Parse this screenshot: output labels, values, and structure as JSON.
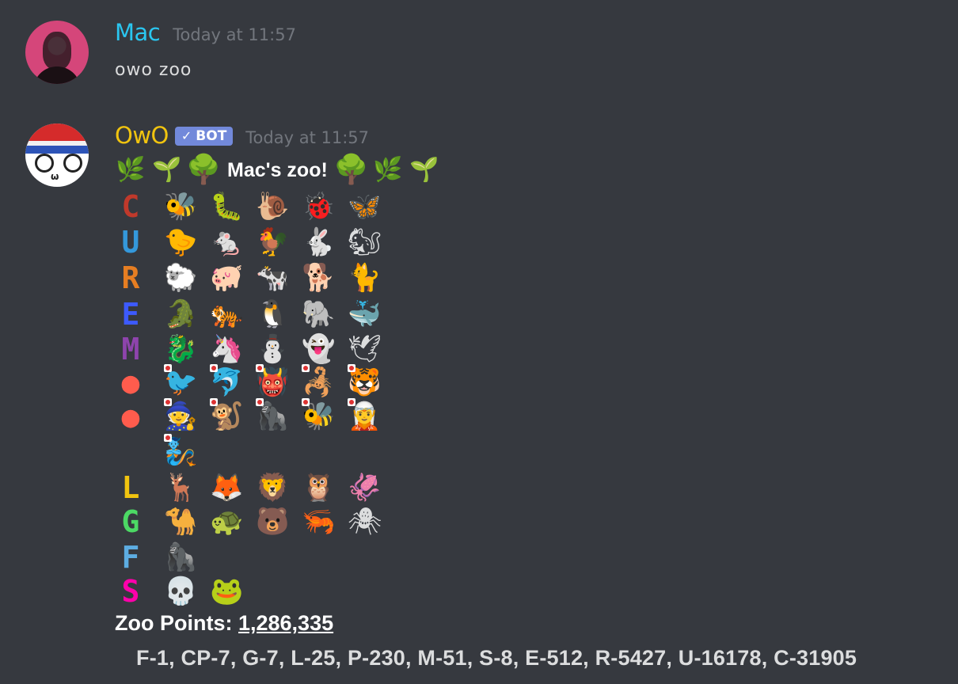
{
  "messages": [
    {
      "username": "Mac",
      "timestamp": "Today at 11:57",
      "content": "owo zoo",
      "avatar": "user-avatar"
    },
    {
      "username": "OwO",
      "bot_tag": "BOT",
      "timestamp": "Today at 11:57",
      "avatar": "owo-bot-avatar"
    }
  ],
  "zoo": {
    "title": "Mac's zoo!",
    "title_decorations_left": [
      "🌿",
      "🌱",
      "🌳"
    ],
    "title_decorations_right": [
      "🌳",
      "🌿",
      "🌱"
    ],
    "rows": [
      {
        "rank": "common",
        "rank_glyph": "C",
        "rank_color": "#c0392b",
        "animals": [
          "🐝",
          "🐛",
          "🐌",
          "🐞",
          "🦋"
        ]
      },
      {
        "rank": "uncommon",
        "rank_glyph": "U",
        "rank_color": "#3498db",
        "animals": [
          "🐤",
          "🐁",
          "🐓",
          "🐇",
          "🐿"
        ]
      },
      {
        "rank": "rare",
        "rank_glyph": "R",
        "rank_color": "#e67e22",
        "animals": [
          "🐑",
          "🐖",
          "🐄",
          "🐕",
          "🐈"
        ]
      },
      {
        "rank": "epic",
        "rank_glyph": "E",
        "rank_color": "#3d5afe",
        "animals": [
          "🐊",
          "🐅",
          "🐧",
          "🐘",
          "🐳"
        ]
      },
      {
        "rank": "mythic",
        "rank_glyph": "M",
        "rank_color": "#8e44ad",
        "animals": [
          "🐉",
          "🦄",
          "⛄",
          "👻",
          "🕊"
        ]
      },
      {
        "rank": "patreon",
        "rank_glyph": "●",
        "rank_color": "#ff5c4d",
        "animals": [
          "🐦",
          "🐬",
          "👹",
          "🦂",
          "🐯"
        ],
        "patreon": true
      },
      {
        "rank": "cpatreon",
        "rank_glyph": "●",
        "rank_color": "#ff5c4d",
        "animals": [
          "🧙",
          "🐒",
          "🦍",
          "🐝",
          "🧝"
        ],
        "patreon": true
      },
      {
        "rank": "cpatreon-extra",
        "rank_glyph": "",
        "rank_color": "#ffffff",
        "animals": [
          "🧞"
        ],
        "patreon": true
      },
      {
        "rank": "legendary",
        "rank_glyph": "L",
        "rank_color": "#f1c40f",
        "animals": [
          "🦌",
          "🦊",
          "🦁",
          "🦉",
          "🦑"
        ]
      },
      {
        "rank": "gemstone",
        "rank_glyph": "G",
        "rank_color": "#4cd964",
        "animals": [
          "🐪",
          "🐢",
          "🐻",
          "🦐",
          "🕷"
        ]
      },
      {
        "rank": "fabled",
        "rank_glyph": "F",
        "rank_color": "#5dade2",
        "animals": [
          "🦍"
        ]
      },
      {
        "rank": "special",
        "rank_glyph": "S",
        "rank_color": "#ff00aa",
        "animals": [
          "💀",
          "🐸"
        ]
      }
    ],
    "points_label": "Zoo Points: ",
    "points_value": "1,286,335",
    "counts": "F-1, CP-7, G-7, L-25, P-230, M-51, S-8, E-512, R-5427, U-16178, C-31905"
  }
}
